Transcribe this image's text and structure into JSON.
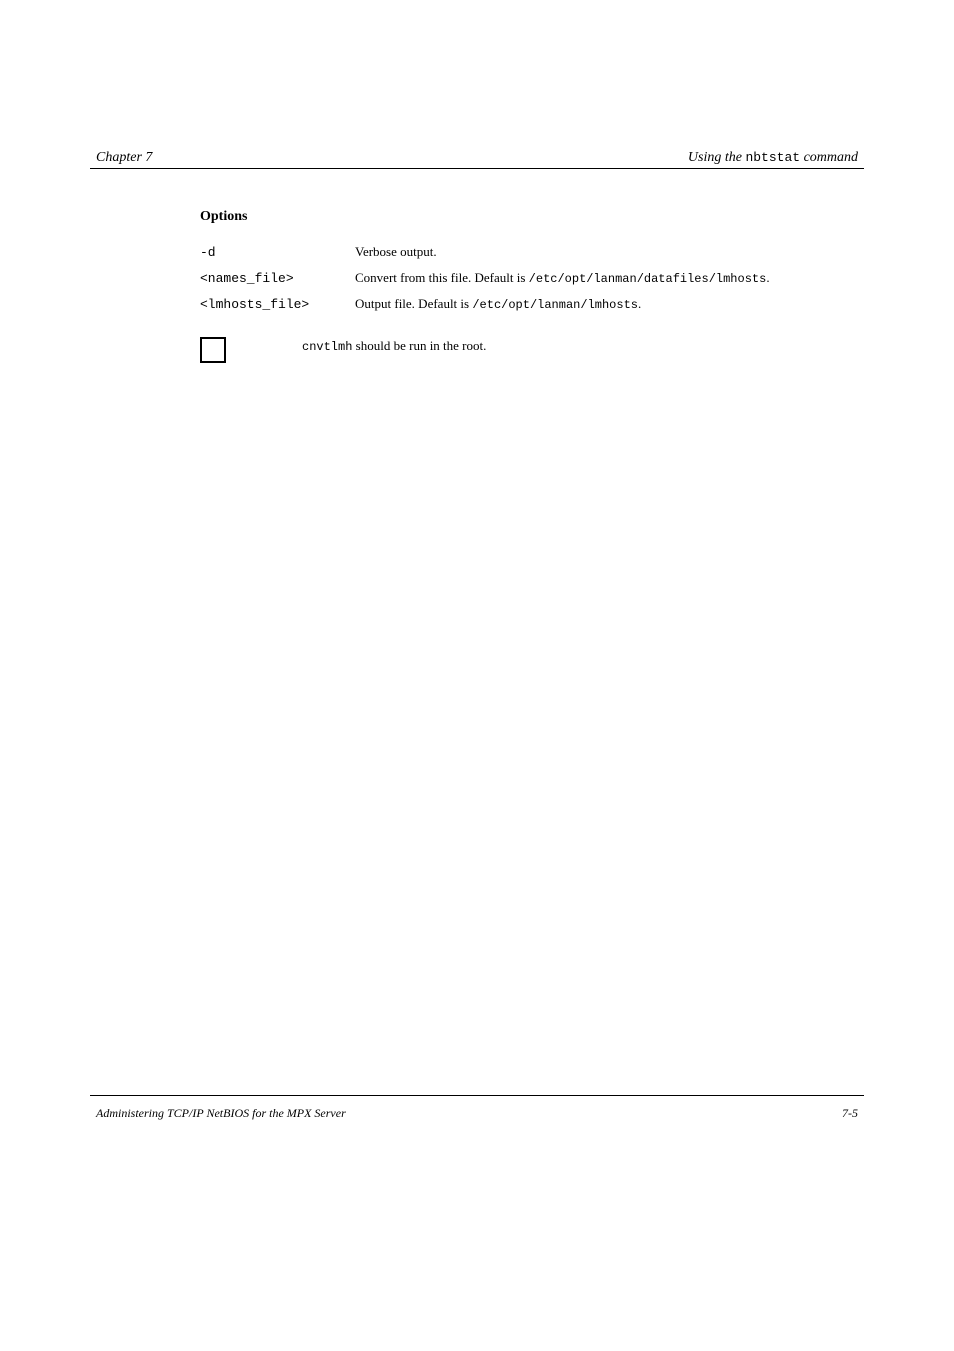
{
  "header": {
    "chapter": "Chapter 7",
    "heading_prefix": "Using the ",
    "heading_cmd": "nbtstat",
    "heading_suffix": " command"
  },
  "content": {
    "options_label": "Options",
    "opt1": {
      "flag": "-d",
      "desc": "Verbose output."
    },
    "opt2": {
      "flag": "<names_file>",
      "desc_pre": "Convert from this file. Default is ",
      "desc_mono": "/etc/opt/lanman/datafiles/lmhosts",
      "desc_post": "."
    },
    "opt3": {
      "flag": "<lmhosts_file>",
      "desc_pre": "Output file. Default is ",
      "desc_mono": "/etc/opt/lanman/lmhosts",
      "desc_post": "."
    },
    "note": {
      "mono": "cnvtlmh",
      "text": " should be run in the root."
    }
  },
  "footer": {
    "left": "Administering TCP/IP NetBIOS for the MPX Server",
    "right": "7-5"
  }
}
